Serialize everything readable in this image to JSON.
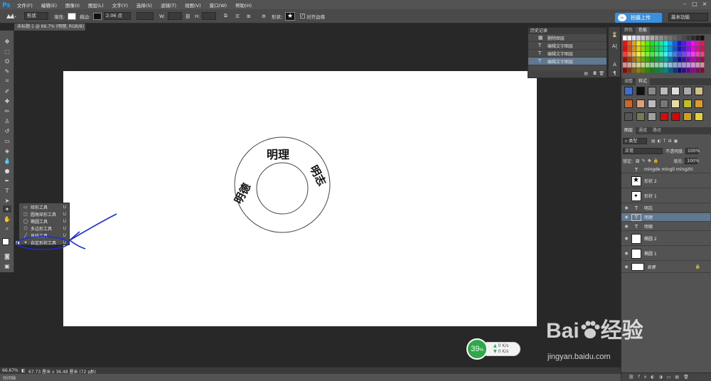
{
  "menubar": {
    "logo": "Ps",
    "items": [
      "文件(F)",
      "编辑(E)",
      "图像(I)",
      "图层(L)",
      "文字(Y)",
      "选择(S)",
      "滤镜(T)",
      "视图(V)",
      "窗口(W)",
      "帮助(H)"
    ]
  },
  "options_bar": {
    "shape_mode": "形状",
    "fill_label": "填充:",
    "stroke_label": "描边:",
    "stroke_width": "2.06 点",
    "w_label": "W:",
    "h_label": "H:",
    "shape_label": "形状:",
    "align_edges": "对齐边缘",
    "upload_label": "拍摄上传",
    "workspace": "基本功能"
  },
  "document": {
    "tab_title": "未标题-1 @ 66.7% (明理, RGB/8) *"
  },
  "history": {
    "title": "历史记录",
    "rows": [
      {
        "icon": "layer-icon",
        "label": "删除图层",
        "selected": false
      },
      {
        "icon": "text-icon",
        "label": "编辑文字图层",
        "selected": false
      },
      {
        "icon": "text-icon",
        "label": "编辑文字图层",
        "selected": false
      },
      {
        "icon": "text-icon",
        "label": "编辑文字图层",
        "selected": true
      }
    ]
  },
  "panels": {
    "swatch_tabs": [
      "颜色",
      "色板"
    ],
    "style_tabs": [
      "调整",
      "样式"
    ],
    "layer_tabs": [
      "图层",
      "通道",
      "路径"
    ]
  },
  "layers_panel": {
    "filter_label": "类型",
    "blend_mode": "正常",
    "opacity_label": "不透明度:",
    "opacity_value": "100%",
    "lock_label": "锁定:",
    "fill_label": "填充:",
    "fill_value": "100%",
    "layers": [
      {
        "type": "text",
        "name": "mingde mingli mingzhi",
        "selected": false,
        "visible": false
      },
      {
        "type": "shape",
        "name": "形状 2",
        "selected": false,
        "visible": false
      },
      {
        "type": "shape",
        "name": "形状 1",
        "selected": false,
        "visible": false
      },
      {
        "type": "text",
        "name": "明志",
        "selected": false,
        "visible": true
      },
      {
        "type": "text",
        "name": "明理",
        "selected": true,
        "visible": true
      },
      {
        "type": "text",
        "name": "明德",
        "selected": false,
        "visible": true
      },
      {
        "type": "shape",
        "name": "椭圆 2",
        "selected": false,
        "visible": true
      },
      {
        "type": "shape",
        "name": "椭圆 1",
        "selected": false,
        "visible": true
      },
      {
        "type": "bg",
        "name": "背景",
        "selected": false,
        "visible": true
      }
    ]
  },
  "tool_flyout": {
    "items": [
      {
        "icon": "rectangle-tool-icon",
        "label": "矩形工具",
        "key": "U"
      },
      {
        "icon": "rounded-rect-tool-icon",
        "label": "圆角矩形工具",
        "key": "U"
      },
      {
        "icon": "ellipse-tool-icon",
        "label": "椭圆工具",
        "key": "U"
      },
      {
        "icon": "polygon-tool-icon",
        "label": "多边形工具",
        "key": "U"
      },
      {
        "icon": "line-tool-icon",
        "label": "直线工具",
        "key": "U"
      },
      {
        "icon": "custom-shape-tool-icon",
        "label": "自定形状工具",
        "key": "U"
      }
    ]
  },
  "canvas_art": {
    "top_text": "明理",
    "left_text": "明德",
    "right_text": "明志"
  },
  "status": {
    "zoom": "66.67%",
    "doc_size": "67.73 厘米 x 36.48 厘米 (72 ppi)",
    "timeline": "时间轴"
  },
  "net_widget": {
    "percent": "39",
    "percent_unit": "%",
    "up": "0 K/s",
    "down": "0 K/s"
  },
  "watermark": {
    "brand_pre": "Bai",
    "brand_post": "经验",
    "url": "jingyan.baidu.com"
  },
  "colors": {
    "selection": "#607890",
    "annotation": "#1a2bd8",
    "badge_green": "#2ea84a",
    "upload_blue": "#3b8fdc"
  }
}
